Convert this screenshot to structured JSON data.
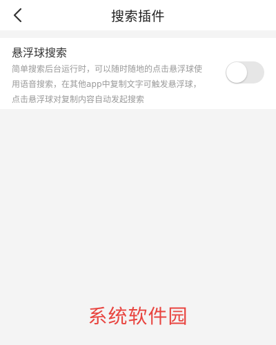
{
  "header": {
    "title": "搜索插件",
    "back_icon": "chevron-left-icon"
  },
  "setting": {
    "title": "悬浮球搜索",
    "description_lines": [
      "简单搜索后台运行时，可以随时随地的点击悬浮球使",
      "用语音搜索，在其他app中复制文字可触发悬浮球，",
      "点击悬浮球对复制内容自动发起搜索"
    ],
    "toggle_on": false
  },
  "watermark": "系统软件园",
  "colors": {
    "background": "#f4f4f4",
    "card": "#ffffff",
    "watermark": "#e8443f",
    "toggle_off": "#e6e6e6"
  }
}
